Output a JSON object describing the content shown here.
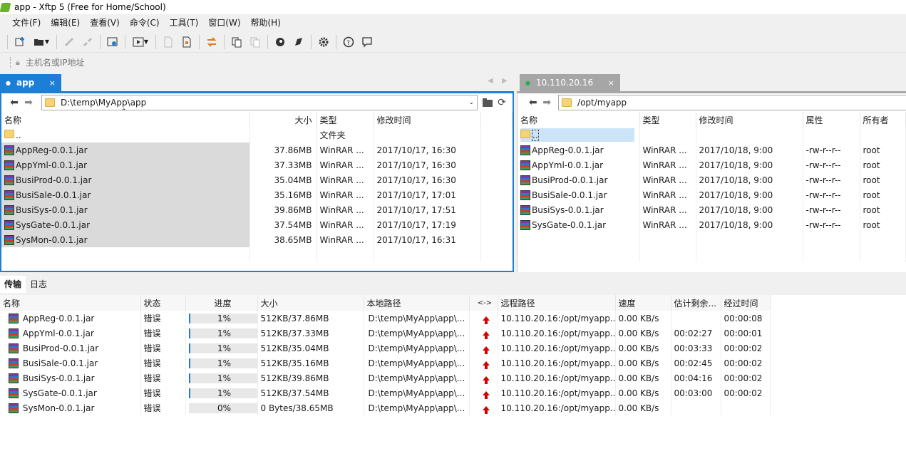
{
  "window": {
    "title": "app - Xftp 5 (Free for Home/School)"
  },
  "menu": [
    "文件(F)",
    "编辑(E)",
    "查看(V)",
    "命令(C)",
    "工具(T)",
    "窗口(W)",
    "帮助(H)"
  ],
  "address_placeholder": "主机名或IP地址",
  "local": {
    "tab": "app",
    "path": "D:\\temp\\MyApp\\app",
    "columns": [
      "名称",
      "大小",
      "类型",
      "修改时间"
    ],
    "rows": [
      {
        "name": "..",
        "size": "",
        "type": "文件夹",
        "mtime": ""
      },
      {
        "name": "AppReg-0.0.1.jar",
        "size": "37.86MB",
        "type": "WinRAR ...",
        "mtime": "2017/10/17, 16:30"
      },
      {
        "name": "AppYml-0.0.1.jar",
        "size": "37.33MB",
        "type": "WinRAR ...",
        "mtime": "2017/10/17, 16:30"
      },
      {
        "name": "BusiProd-0.0.1.jar",
        "size": "35.04MB",
        "type": "WinRAR ...",
        "mtime": "2017/10/17, 16:30"
      },
      {
        "name": "BusiSale-0.0.1.jar",
        "size": "35.16MB",
        "type": "WinRAR ...",
        "mtime": "2017/10/17, 17:01"
      },
      {
        "name": "BusiSys-0.0.1.jar",
        "size": "39.86MB",
        "type": "WinRAR ...",
        "mtime": "2017/10/17, 17:51"
      },
      {
        "name": "SysGate-0.0.1.jar",
        "size": "37.54MB",
        "type": "WinRAR ...",
        "mtime": "2017/10/17, 17:19"
      },
      {
        "name": "SysMon-0.0.1.jar",
        "size": "38.65MB",
        "type": "WinRAR ...",
        "mtime": "2017/10/17, 16:31"
      }
    ]
  },
  "remote": {
    "tab": "10.110.20.16",
    "path": "/opt/myapp",
    "columns": [
      "名称",
      "类型",
      "修改时间",
      "属性",
      "所有者"
    ],
    "rows": [
      {
        "name": "..",
        "type": "",
        "mtime": "",
        "attr": "",
        "owner": ""
      },
      {
        "name": "AppReg-0.0.1.jar",
        "type": "WinRAR ...",
        "mtime": "2017/10/18, 9:00",
        "attr": "-rw-r--r--",
        "owner": "root"
      },
      {
        "name": "AppYml-0.0.1.jar",
        "type": "WinRAR ...",
        "mtime": "2017/10/18, 9:00",
        "attr": "-rw-r--r--",
        "owner": "root"
      },
      {
        "name": "BusiProd-0.0.1.jar",
        "type": "WinRAR ...",
        "mtime": "2017/10/18, 9:00",
        "attr": "-rw-r--r--",
        "owner": "root"
      },
      {
        "name": "BusiSale-0.0.1.jar",
        "type": "WinRAR ...",
        "mtime": "2017/10/18, 9:00",
        "attr": "-rw-r--r--",
        "owner": "root"
      },
      {
        "name": "BusiSys-0.0.1.jar",
        "type": "WinRAR ...",
        "mtime": "2017/10/18, 9:00",
        "attr": "-rw-r--r--",
        "owner": "root"
      },
      {
        "name": "SysGate-0.0.1.jar",
        "type": "WinRAR ...",
        "mtime": "2017/10/18, 9:00",
        "attr": "-rw-r--r--",
        "owner": "root"
      }
    ]
  },
  "bottom_tabs": [
    "传输",
    "日志"
  ],
  "transfer": {
    "columns": [
      "名称",
      "状态",
      "进度",
      "大小",
      "本地路径",
      "<->",
      "远程路径",
      "速度",
      "估计剩余...",
      "经过时间"
    ],
    "rows": [
      {
        "name": "AppReg-0.0.1.jar",
        "status": "错误",
        "progress": "1%",
        "size": "512KB/37.86MB",
        "local": "D:\\temp\\MyApp\\app\\...",
        "remote": "10.110.20.16:/opt/myapp...",
        "speed": "0.00 KB/s",
        "eta": "",
        "elapsed": "00:00:08"
      },
      {
        "name": "AppYml-0.0.1.jar",
        "status": "错误",
        "progress": "1%",
        "size": "512KB/37.33MB",
        "local": "D:\\temp\\MyApp\\app\\...",
        "remote": "10.110.20.16:/opt/myapp...",
        "speed": "0.00 KB/s",
        "eta": "00:02:27",
        "elapsed": "00:00:01"
      },
      {
        "name": "BusiProd-0.0.1.jar",
        "status": "错误",
        "progress": "1%",
        "size": "512KB/35.04MB",
        "local": "D:\\temp\\MyApp\\app\\...",
        "remote": "10.110.20.16:/opt/myapp...",
        "speed": "0.00 KB/s",
        "eta": "00:03:33",
        "elapsed": "00:00:02"
      },
      {
        "name": "BusiSale-0.0.1.jar",
        "status": "错误",
        "progress": "1%",
        "size": "512KB/35.16MB",
        "local": "D:\\temp\\MyApp\\app\\...",
        "remote": "10.110.20.16:/opt/myapp...",
        "speed": "0.00 KB/s",
        "eta": "00:02:45",
        "elapsed": "00:00:02"
      },
      {
        "name": "BusiSys-0.0.1.jar",
        "status": "错误",
        "progress": "1%",
        "size": "512KB/39.86MB",
        "local": "D:\\temp\\MyApp\\app\\...",
        "remote": "10.110.20.16:/opt/myapp...",
        "speed": "0.00 KB/s",
        "eta": "00:04:16",
        "elapsed": "00:00:02"
      },
      {
        "name": "SysGate-0.0.1.jar",
        "status": "错误",
        "progress": "1%",
        "size": "512KB/37.54MB",
        "local": "D:\\temp\\MyApp\\app\\...",
        "remote": "10.110.20.16:/opt/myapp...",
        "speed": "0.00 KB/s",
        "eta": "00:03:00",
        "elapsed": "00:00:02"
      },
      {
        "name": "SysMon-0.0.1.jar",
        "status": "错误",
        "progress": "0%",
        "size": "0 Bytes/38.65MB",
        "local": "D:\\temp\\MyApp\\app\\...",
        "remote": "10.110.20.16:/opt/myapp...",
        "speed": "0.00 KB/s",
        "eta": "",
        "elapsed": ""
      }
    ]
  },
  "colors": {
    "accent": "#1c7fd4",
    "connected": "#22b14c",
    "error_arrow": "#d40000"
  }
}
